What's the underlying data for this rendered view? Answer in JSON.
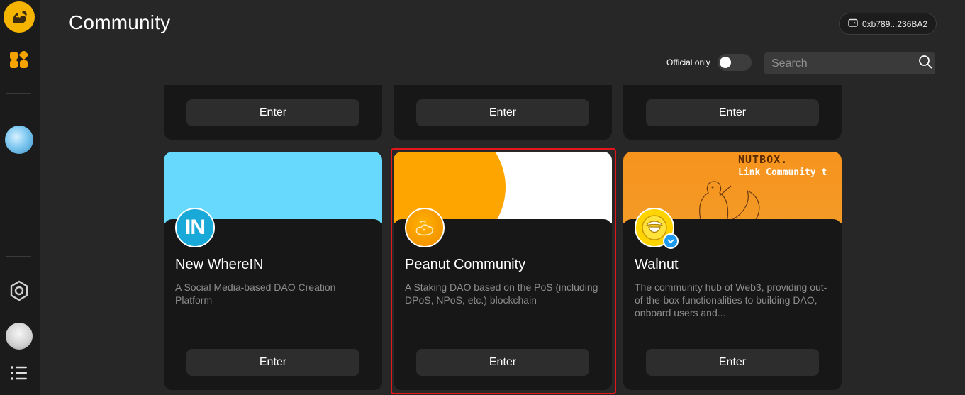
{
  "header": {
    "title": "Community",
    "wallet_address": "0xb789...236BA2",
    "official_only_label": "Official only",
    "official_only_enabled": false,
    "search_placeholder": "Search"
  },
  "sidebar": {
    "items": [
      {
        "name": "nutbox-logo-icon"
      },
      {
        "name": "apps-icon"
      },
      {
        "name": "joined-community-avatar"
      },
      {
        "name": "settings-hexagon-icon"
      },
      {
        "name": "user-avatar"
      },
      {
        "name": "menu-list-icon"
      }
    ]
  },
  "top_row": {
    "cards": [
      {
        "enter_label": "Enter"
      },
      {
        "enter_label": "Enter"
      },
      {
        "enter_label": "Enter"
      }
    ]
  },
  "communities": [
    {
      "name": "New WhereIN",
      "description": "A Social Media-based DAO Creation Platform",
      "enter_label": "Enter",
      "cover_color": "#66d9fc",
      "avatar_text": "IN",
      "verified": false
    },
    {
      "name": "Peanut Community",
      "description": "A Staking DAO based on the PoS (including DPoS, NPoS, etc.) blockchain",
      "enter_label": "Enter",
      "cover_color": "#ffa500",
      "verified": false,
      "highlighted": true
    },
    {
      "name": "Walnut",
      "description": "The community hub of Web3, providing out-of-the-box functionalities to building DAO, onboard users and...",
      "enter_label": "Enter",
      "cover_color": "#f7941d",
      "cover_text_1": "NUTBOX.",
      "cover_text_2": "Link Community t",
      "verified": true
    }
  ],
  "colors": {
    "background": "#272727",
    "sidebar": "#1b1b1b",
    "card": "#171717",
    "button": "#2d2d2d",
    "accent": "#f5b400",
    "highlight_border": "#e4161b",
    "verified_badge": "#1e9af0"
  }
}
